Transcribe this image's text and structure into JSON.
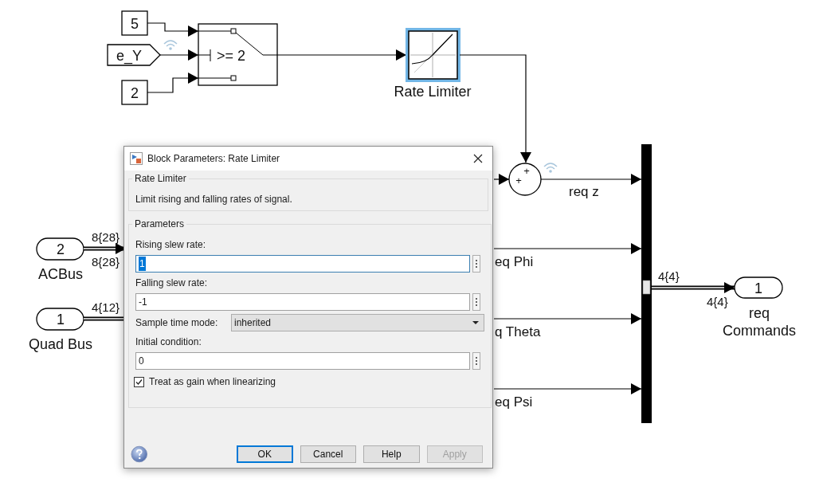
{
  "diagram": {
    "constants": [
      {
        "value": "5"
      },
      {
        "value": "2"
      }
    ],
    "goto_tag": {
      "label": "e_Y"
    },
    "switch": {
      "criteria": ">= 2"
    },
    "rate_limiter": {
      "label": "Rate Limiter",
      "selected": true
    },
    "sum": {
      "signs": [
        "+",
        "+"
      ]
    },
    "signals": [
      {
        "label": "req z"
      },
      {
        "label": "eq Phi"
      },
      {
        "label": "q Theta"
      },
      {
        "label": "eq Psi"
      }
    ],
    "inports": [
      {
        "number": "2",
        "label": "ACBus",
        "width_top": "8{28}",
        "width_bottom": "8{28}"
      },
      {
        "number": "1",
        "label": "Quad Bus",
        "width_top": "4{12}"
      }
    ],
    "mux_output": {
      "width_top": "4{4}",
      "width_bottom": "4{4}"
    },
    "outport": {
      "number": "1",
      "label_lines": [
        "req",
        "Commands"
      ]
    }
  },
  "dialog": {
    "title": "Block Parameters: Rate Limiter",
    "block_group": {
      "title": "Rate Limiter",
      "description": "Limit rising and falling rates of signal."
    },
    "parameters_group": {
      "title": "Parameters",
      "fields": [
        {
          "kind": "text",
          "label": "Rising slew rate:",
          "value": "1",
          "focused": true
        },
        {
          "kind": "text",
          "label": "Falling slew rate:",
          "value": "-1",
          "focused": false
        },
        {
          "kind": "select",
          "label": "Sample time mode:",
          "value": "inherited"
        },
        {
          "kind": "text",
          "label": "Initial condition:",
          "value": "0",
          "focused": false
        },
        {
          "kind": "checkbox",
          "label": "Treat as gain when linearizing",
          "checked": true
        }
      ]
    },
    "buttons": [
      {
        "label": "OK",
        "default": true,
        "disabled": false
      },
      {
        "label": "Cancel",
        "default": false,
        "disabled": false
      },
      {
        "label": "Help",
        "default": false,
        "disabled": false
      },
      {
        "label": "Apply",
        "default": false,
        "disabled": true
      }
    ]
  }
}
